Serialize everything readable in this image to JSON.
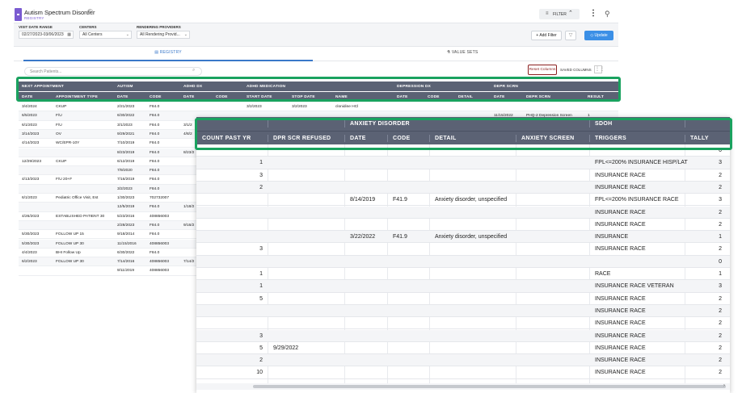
{
  "app": {
    "title": "Autism Spectrum Disorder",
    "info_icon": "i",
    "subtitle": "REGISTRY",
    "filter_label": "FILTER",
    "filter_icon": "≡",
    "filter_chevron": "⌃",
    "kebab_icon": "⋮",
    "pin_icon": "⚲",
    "accent_color": "#7a5bd1"
  },
  "filters": {
    "visit_date_label": "VISIT DATE RANGE",
    "visit_date_value": "02/27/2023-03/06/2023",
    "calendar_icon": "▦",
    "centers_label": "CENTERS",
    "centers_value": "All Centers",
    "providers_label": "RENDERING PROVIDERS",
    "providers_value": "All Rendering Provid...",
    "caret": "⌄",
    "add_filter": "+ Add Filter",
    "funnel_icon": "▽",
    "update": "◇ Update"
  },
  "tabs": {
    "registry": "▤  REGISTRY",
    "value_sets": "⚗  VALUE SETS"
  },
  "search": {
    "placeholder": "Search Patients...",
    "icon": "⌕"
  },
  "toolbar": {
    "reset_columns": "Reset Columns",
    "saved_columns": "SAVED COLUMNS",
    "columns_icon": "⋮⋮"
  },
  "grid1": {
    "groups": [
      "NEXT APPOINTMENT",
      "AUTISM",
      "ADHD DX",
      "ADHD MEDICATION",
      "DEPRESSION DX",
      "DEPR SCRN"
    ],
    "columns": [
      "DATE",
      "APPOINTMENT TYPE",
      "DATE",
      "CODE",
      "DATE",
      "CODE",
      "START DATE",
      "STOP DATE",
      "NAME",
      "DATE",
      "CODE",
      "DETAIL",
      "DATE",
      "DEPR SCRN",
      "RESULT"
    ],
    "rows": [
      [
        "3/4/2024",
        "CKUP",
        "2/21/2023",
        "F84.0",
        "",
        "",
        "3/2/2023",
        "3/2/2023",
        "clonidine HCl",
        "",
        "",
        "",
        "",
        "",
        ""
      ],
      [
        "6/5/2023",
        "F/U",
        "6/30/2022",
        "F84.0",
        "",
        "",
        "",
        "",
        "",
        "",
        "",
        "",
        "11/15/2022",
        "PHQ-2 Depression Screen",
        "1"
      ],
      [
        "6/1/2023",
        "F/U",
        "3/1/2023",
        "F84.0",
        "3/1/2",
        "",
        "",
        "",
        "",
        "",
        "",
        "",
        "",
        "",
        ""
      ],
      [
        "3/14/2023",
        "OV",
        "9/29/2021",
        "F84.0",
        "4/8/2",
        "",
        "",
        "",
        "",
        "",
        "",
        "",
        "",
        "",
        ""
      ],
      [
        "4/14/2023",
        "WC/EPR-10Y",
        "7/10/2019",
        "F84.0",
        "",
        "",
        "",
        "",
        "",
        "",
        "",
        "",
        "",
        "",
        ""
      ],
      [
        "",
        "",
        "8/23/2019",
        "F84.0",
        "8/23/2",
        "",
        "",
        "",
        "",
        "",
        "",
        "",
        "",
        "",
        ""
      ],
      [
        "12/29/2023",
        "CKUP",
        "6/12/2019",
        "F84.0",
        "",
        "",
        "",
        "",
        "",
        "",
        "",
        "",
        "",
        "",
        ""
      ],
      [
        "",
        "",
        "7/9/2020",
        "F84.0",
        "",
        "",
        "",
        "",
        "",
        "",
        "",
        "",
        "",
        "",
        ""
      ],
      [
        "4/13/2023",
        "F/U 20+F",
        "7/16/2019",
        "F84.0",
        "",
        "",
        "",
        "",
        "",
        "",
        "",
        "",
        "",
        "",
        ""
      ],
      [
        "",
        "",
        "3/2/2023",
        "F84.0",
        "",
        "",
        "",
        "",
        "",
        "",
        "",
        "",
        "",
        "",
        ""
      ],
      [
        "6/1/2023",
        "Pediatric Office Visit, Est",
        "1/30/2023",
        "702732007",
        "",
        "",
        "",
        "",
        "",
        "",
        "",
        "",
        "",
        "",
        ""
      ],
      [
        "",
        "",
        "12/5/2019",
        "F84.0",
        "1/18/2",
        "",
        "",
        "",
        "",
        "",
        "",
        "",
        "",
        "",
        ""
      ],
      [
        "4/26/2023",
        "ESTABLISHED PATIENT 30",
        "5/23/2016",
        "408856003",
        "",
        "",
        "",
        "",
        "",
        "",
        "",
        "",
        "",
        "",
        ""
      ],
      [
        "",
        "",
        "2/28/2023",
        "F84.0",
        "9/16/2",
        "",
        "",
        "",
        "",
        "",
        "",
        "",
        "",
        "",
        ""
      ],
      [
        "5/30/2023",
        "FOLLOW UP 15",
        "9/18/2014",
        "F84.0",
        "",
        "",
        "",
        "",
        "",
        "",
        "",
        "",
        "",
        "",
        ""
      ],
      [
        "5/30/2023",
        "FOLLOW UP 30",
        "11/15/2016",
        "408856003",
        "",
        "",
        "",
        "",
        "",
        "",
        "",
        "",
        "",
        "",
        ""
      ],
      [
        "4/4/2023",
        "BHI Follow Up",
        "6/30/2022",
        "F84.0",
        "",
        "",
        "",
        "",
        "",
        "",
        "",
        "",
        "",
        "",
        ""
      ],
      [
        "6/2/2023",
        "FOLLOW UP 30",
        "7/14/2016",
        "408856003",
        "7/14/2",
        "",
        "",
        "",
        "",
        "",
        "",
        "",
        "",
        "",
        ""
      ],
      [
        "",
        "",
        "9/11/2019",
        "408856003",
        "",
        "",
        "",
        "",
        "",
        "",
        "",
        "",
        "",
        "",
        ""
      ]
    ],
    "scroll_arrow": "‹"
  },
  "zoom": {
    "groups": [
      "ANXIETY DISORDER",
      "SDOH"
    ],
    "columns": [
      "COUNT PAST YR",
      "DPR SCR REFUSED",
      "DATE",
      "CODE",
      "DETAIL",
      "ANXIETY SCREEN",
      "TRIGGERS",
      "TALLY"
    ],
    "rows": [
      [
        "",
        "",
        "",
        "",
        "",
        "",
        "",
        "0"
      ],
      [
        "1",
        "",
        "",
        "",
        "",
        "",
        "FPL<=200% INSURANCE HISP/LAT",
        "3"
      ],
      [
        "3",
        "",
        "",
        "",
        "",
        "",
        "INSURANCE RACE",
        "2"
      ],
      [
        "2",
        "",
        "",
        "",
        "",
        "",
        "INSURANCE RACE",
        "2"
      ],
      [
        "",
        "",
        "8/14/2019",
        "F41.9",
        "Anxiety disorder, unspecified",
        "",
        "FPL<=200% INSURANCE RACE",
        "3"
      ],
      [
        "",
        "",
        "",
        "",
        "",
        "",
        "INSURANCE RACE",
        "2"
      ],
      [
        "",
        "",
        "",
        "",
        "",
        "",
        "INSURANCE RACE",
        "2"
      ],
      [
        "",
        "",
        "3/22/2022",
        "F41.9",
        "Anxiety disorder, unspecified",
        "",
        "INSURANCE",
        "1"
      ],
      [
        "3",
        "",
        "",
        "",
        "",
        "",
        "INSURANCE RACE",
        "2"
      ],
      [
        "",
        "",
        "",
        "",
        "",
        "",
        "",
        "0"
      ],
      [
        "1",
        "",
        "",
        "",
        "",
        "",
        "RACE",
        "1"
      ],
      [
        "1",
        "",
        "",
        "",
        "",
        "",
        "INSURANCE RACE VETERAN",
        "3"
      ],
      [
        "5",
        "",
        "",
        "",
        "",
        "",
        "INSURANCE RACE",
        "2"
      ],
      [
        "",
        "",
        "",
        "",
        "",
        "",
        "INSURANCE RACE",
        "2"
      ],
      [
        "",
        "",
        "",
        "",
        "",
        "",
        "INSURANCE RACE",
        "2"
      ],
      [
        "3",
        "",
        "",
        "",
        "",
        "",
        "INSURANCE RACE",
        "2"
      ],
      [
        "5",
        "9/29/2022",
        "",
        "",
        "",
        "",
        "INSURANCE RACE",
        "2"
      ],
      [
        "2",
        "",
        "",
        "",
        "",
        "",
        "INSURANCE RACE",
        "2"
      ],
      [
        "10",
        "",
        "",
        "",
        "",
        "",
        "INSURANCE RACE",
        "2"
      ]
    ],
    "scroll_arrow": "›"
  },
  "colors": {
    "header": "#5b6274",
    "highlight": "#1aa25f",
    "reset": "#8a1e1e",
    "primary": "#3b8fe6"
  }
}
